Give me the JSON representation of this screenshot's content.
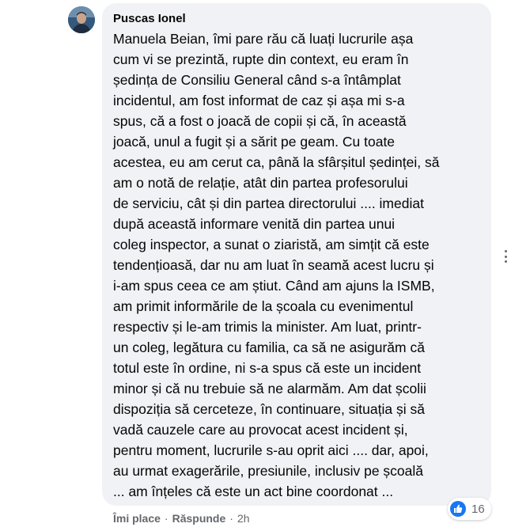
{
  "comment": {
    "author": "Puscas Ionel",
    "avatar_icon": "profile-photo",
    "lines": [
      "Manuela Beian, îmi pare rău că luați lucrurile așa",
      "cum vi se prezintă, rupte din context, eu eram în",
      "ședința de Consiliu General când s-a întâmplat",
      "incidentul, am fost informat de caz și așa mi s-a",
      "spus, că a fost o joacă de copii și că, în această",
      "joacă, unul a fugit și a sărit pe geam. Cu toate",
      "acestea, eu am cerut ca, până la sfârșitul ședinței, să",
      "am o notă de relație, atât din partea profesorului",
      "de serviciu, cât și din partea directorului .... imediat",
      "după această informare venită din partea unui",
      "coleg inspector, a sunat o ziaristă, am simțit că este",
      "tendențioasă, dar nu am luat în seamă acest lucru și",
      "i-am spus ceea ce am știut. Când am ajuns la ISMB,",
      "am primit informările de la școala cu evenimentul",
      "respectiv și le-am trimis la minister. Am luat, printr-",
      "un coleg, legătura cu familia, ca să ne asigurăm că",
      "totul este în ordine, ni s-a spus că este un incident",
      "minor și că nu trebuie să ne alarmăm. Am dat școlii",
      "dispoziția să cerceteze, în continuare, situația și să",
      "vadă cauzele care au provocat acest incident și,",
      "pentru moment, lucrurile s-au oprit aici .... dar, apoi,",
      "au urmat exagerările, presiunile, inclusiv pe școală",
      "... am înțeles că este un act bine coordonat ..."
    ],
    "reactions": {
      "icon": "like-icon",
      "count": "16",
      "color": "#1877f2"
    },
    "actions": {
      "like_label": "Îmi place",
      "separator": "·",
      "reply_label": "Răspunde",
      "time": "2h"
    },
    "more_icon": "more-options-icon"
  }
}
